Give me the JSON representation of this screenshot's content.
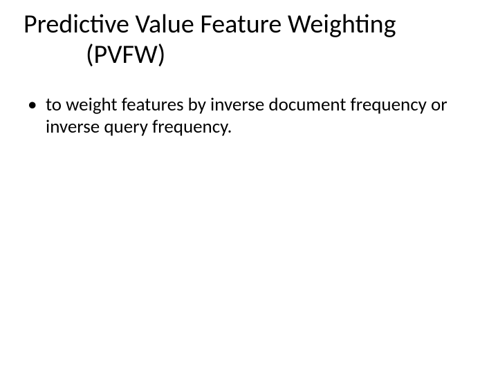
{
  "title": {
    "line1": "Predictive Value Feature Weighting",
    "line2": "(PVFW)"
  },
  "bullets": [
    "to weight features by inverse document frequency or inverse query frequency."
  ]
}
